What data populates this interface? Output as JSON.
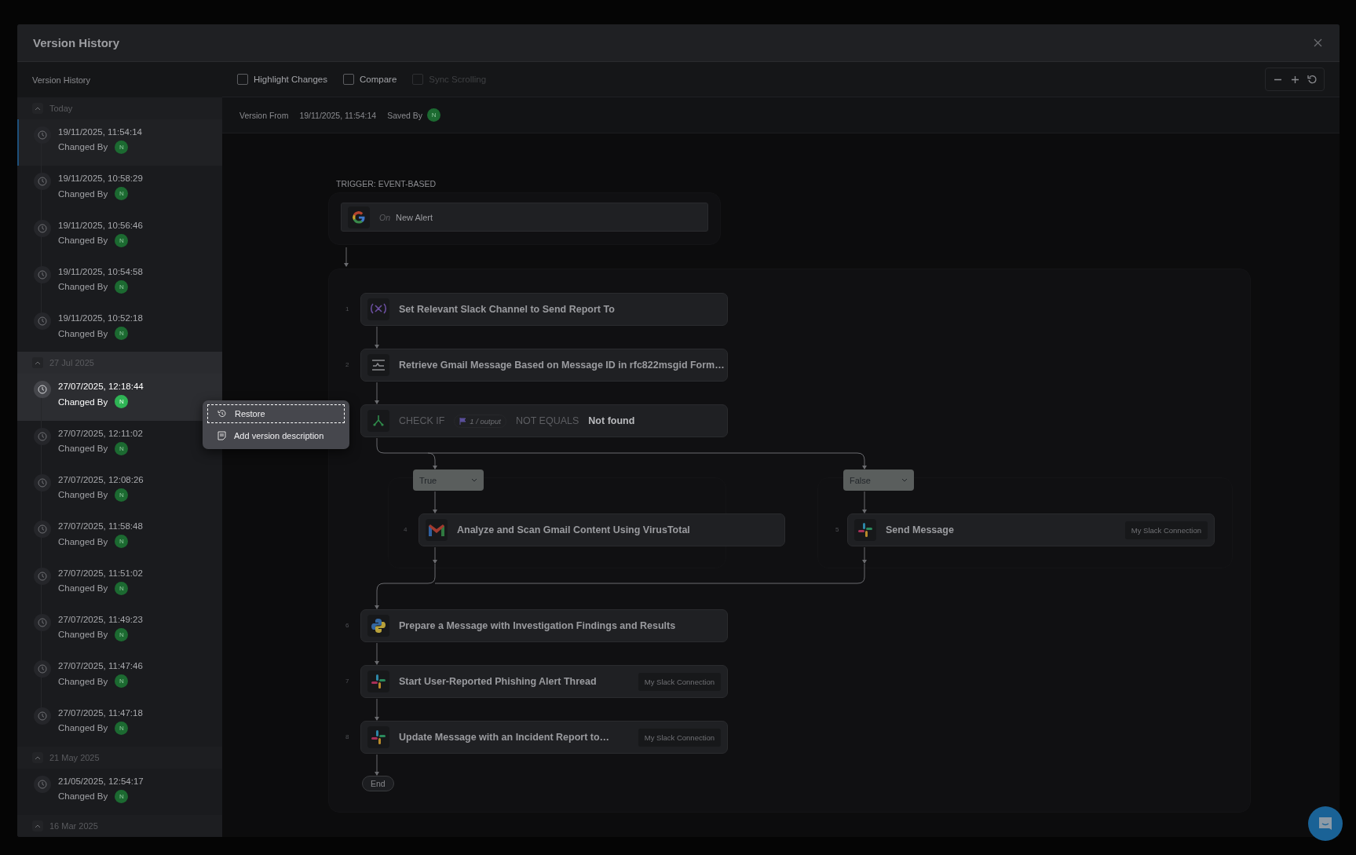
{
  "modal": {
    "title": "Version History"
  },
  "sidebar": {
    "title": "Version History",
    "groups": [
      {
        "label": "Today",
        "expanded": true,
        "versions": [
          {
            "timestamp": "19/11/2025, 11:54:14",
            "changed_by": "Changed By",
            "avatar": "N",
            "current": true,
            "selected": false
          },
          {
            "timestamp": "19/11/2025, 10:58:29",
            "changed_by": "Changed By",
            "avatar": "N",
            "current": false,
            "selected": false
          },
          {
            "timestamp": "19/11/2025, 10:56:46",
            "changed_by": "Changed By",
            "avatar": "N",
            "current": false,
            "selected": false
          },
          {
            "timestamp": "19/11/2025, 10:54:58",
            "changed_by": "Changed By",
            "avatar": "N",
            "current": false,
            "selected": false
          },
          {
            "timestamp": "19/11/2025, 10:52:18",
            "changed_by": "Changed By",
            "avatar": "N",
            "current": false,
            "selected": false
          }
        ]
      },
      {
        "label": "27 Jul 2025",
        "expanded": true,
        "versions": [
          {
            "timestamp": "27/07/2025, 12:18:44",
            "changed_by": "Changed By",
            "avatar": "N",
            "current": false,
            "selected": true
          },
          {
            "timestamp": "27/07/2025, 12:11:02",
            "changed_by": "Changed By",
            "avatar": "N",
            "current": false,
            "selected": false
          },
          {
            "timestamp": "27/07/2025, 12:08:26",
            "changed_by": "Changed By",
            "avatar": "N",
            "current": false,
            "selected": false
          },
          {
            "timestamp": "27/07/2025, 11:58:48",
            "changed_by": "Changed By",
            "avatar": "N",
            "current": false,
            "selected": false
          },
          {
            "timestamp": "27/07/2025, 11:51:02",
            "changed_by": "Changed By",
            "avatar": "N",
            "current": false,
            "selected": false
          },
          {
            "timestamp": "27/07/2025, 11:49:23",
            "changed_by": "Changed By",
            "avatar": "N",
            "current": false,
            "selected": false
          },
          {
            "timestamp": "27/07/2025, 11:47:46",
            "changed_by": "Changed By",
            "avatar": "N",
            "current": false,
            "selected": false
          },
          {
            "timestamp": "27/07/2025, 11:47:18",
            "changed_by": "Changed By",
            "avatar": "N",
            "current": false,
            "selected": false
          }
        ]
      },
      {
        "label": "21 May 2025",
        "expanded": true,
        "versions": [
          {
            "timestamp": "21/05/2025, 12:54:17",
            "changed_by": "Changed By",
            "avatar": "N",
            "current": false,
            "selected": false
          }
        ]
      },
      {
        "label": "16 Mar 2025",
        "expanded": true
      }
    ]
  },
  "context_menu": {
    "items": [
      {
        "label": "Restore",
        "kind": "restore",
        "focused": true
      },
      {
        "label": "Add version description",
        "kind": "note",
        "focused": false
      }
    ]
  },
  "toolbar": {
    "options": [
      {
        "label": "Highlight Changes",
        "checked": false,
        "disabled": false
      },
      {
        "label": "Compare",
        "checked": false,
        "disabled": false
      },
      {
        "label": "Sync Scrolling",
        "checked": false,
        "disabled": true
      }
    ],
    "zoom_controls": [
      {
        "kind": "zoom-out"
      },
      {
        "kind": "zoom-in"
      },
      {
        "kind": "reset"
      }
    ]
  },
  "version_info": {
    "from_label": "Version From",
    "from_value": "19/11/2025, 11:54:14",
    "saved_by_label": "Saved By",
    "saved_by_avatar": "N"
  },
  "workflow": {
    "trigger_label": "TRIGGER: EVENT-BASED",
    "trigger": {
      "prefix": "On",
      "title": "New Alert"
    },
    "steps_before": [
      {
        "number": "1",
        "title": "Set Relevant Slack Channel to Send Report To"
      },
      {
        "number": "2",
        "title": "Retrieve Gmail Message Based on Message ID in rfc822msgid Form…"
      }
    ],
    "condition": {
      "keyword": "CHECK IF",
      "token": "1 / output",
      "operator": "NOT EQUALS",
      "value": "Not found"
    },
    "branches": [
      {
        "label": "True",
        "step": {
          "number": "4",
          "title": "Analyze and Scan Gmail Content Using VirusTotal"
        }
      },
      {
        "label": "False",
        "step": {
          "number": "5",
          "title": "Send Message",
          "connection": "My Slack Connection"
        }
      }
    ],
    "steps_after": [
      {
        "number": "6",
        "title": "Prepare a Message with Investigation Findings and Results"
      },
      {
        "number": "7",
        "title": "Start User-Reported Phishing Alert Thread",
        "connection": "My Slack Connection"
      },
      {
        "number": "8",
        "title": "Update Message with an Incident Report to…",
        "connection": "My Slack Connection"
      }
    ],
    "end_label": "End"
  }
}
